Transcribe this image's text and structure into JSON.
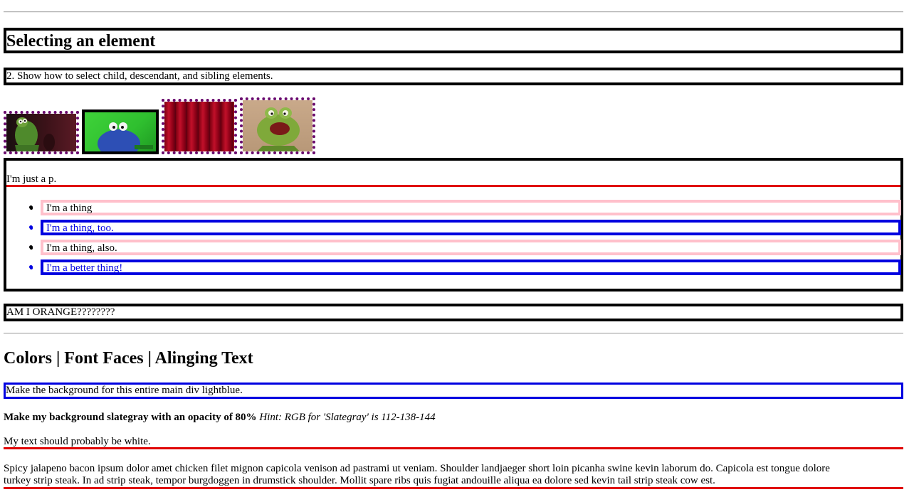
{
  "section1": {
    "heading": "Selecting an element",
    "instruction": "2. Show how to select child, descendant, and sibling elements.",
    "images": [
      {
        "name": "kermit-thinking-image",
        "border": "dotted"
      },
      {
        "name": "cookie-monster-greenscreen-image",
        "border": "solid"
      },
      {
        "name": "red-curtain-image",
        "border": "dotted"
      },
      {
        "name": "kermit-yelling-image",
        "border": "dotted"
      }
    ],
    "p_text": "I'm just a p.",
    "list_items": [
      {
        "label": "I'm a thing",
        "style": "pink"
      },
      {
        "label": "I'm a thing, too.",
        "style": "blue"
      },
      {
        "label": "I'm a thing, also.",
        "style": "pink"
      },
      {
        "label": "I'm a better thing!",
        "style": "blue"
      }
    ],
    "orange_text": "AM I ORANGE????????"
  },
  "section2": {
    "heading": "Colors | Font Faces | Alinging Text",
    "lightblue_text": "Make the background for this entire main div lightblue.",
    "slategray_bold": "Make my background slategray with an opacity of 80%",
    "slategray_hint": "Hint: RGB for 'Slategray' is 112-138-144",
    "white_text": "My text should probably be white.",
    "lorem_line1": "Spicy jalapeno bacon ipsum dolor amet chicken filet mignon capicola venison ad pastrami ut veniam. Shoulder landjaeger short loin picanha swine kevin laborum do. Capicola est tongue dolore",
    "lorem_line2": "turkey strip steak. In ad strip steak, tempor burgdoggen in drumstick shoulder. Mollit spare ribs quis fugiat andouille aliqua ea dolore sed kevin tail strip steak cow est."
  },
  "colors": {
    "border_black": "#000000",
    "dotted_purple": "#6a0a6e",
    "pink": "#ffc0cb",
    "blue": "#0000e0",
    "red": "#e00000"
  }
}
